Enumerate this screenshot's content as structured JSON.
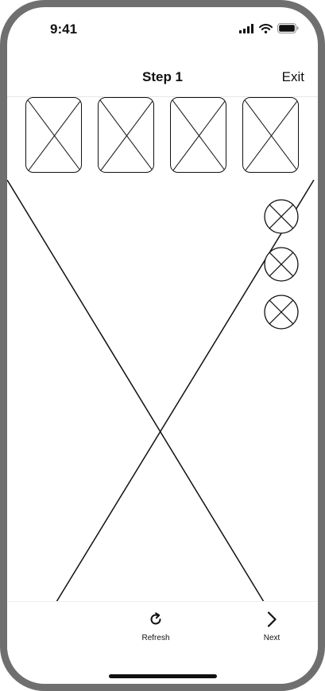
{
  "status_bar": {
    "time": "9:41",
    "icons": [
      "cellular-signal-icon",
      "wifi-icon",
      "battery-icon"
    ]
  },
  "nav": {
    "title": "Step 1",
    "exit_label": "Exit"
  },
  "thumbnails": [
    "image-placeholder",
    "image-placeholder",
    "image-placeholder",
    "image-placeholder"
  ],
  "side_buttons": [
    "close-circle-icon",
    "close-circle-icon",
    "close-circle-icon"
  ],
  "bottom_bar": {
    "refresh_label": "Refresh",
    "next_label": "Next"
  },
  "colors": {
    "frame": "#6f6f6f",
    "stroke": "#111111",
    "background": "#ffffff"
  }
}
